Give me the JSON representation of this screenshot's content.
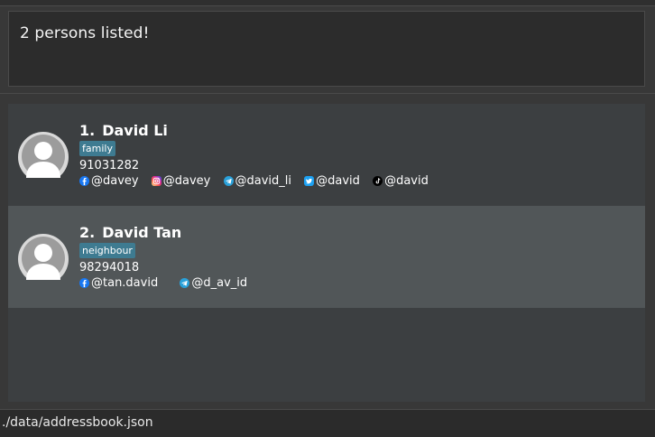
{
  "result_display": {
    "text": "2 persons listed!"
  },
  "persons": [
    {
      "index": "1.",
      "name": "David Li",
      "tag": "family",
      "phone": "91031282",
      "socials": [
        {
          "icon": "facebook-icon",
          "handle": "@davey",
          "color": "#1877f2"
        },
        {
          "icon": "instagram-icon",
          "handle": "@davey",
          "color": "#d6249f"
        },
        {
          "icon": "telegram-icon",
          "handle": "@david_li",
          "color": "#2aa1da"
        },
        {
          "icon": "twitter-icon",
          "handle": "@david",
          "color": "#1da1f2"
        },
        {
          "icon": "tiktok-icon",
          "handle": "@david",
          "color": "#000000"
        }
      ]
    },
    {
      "index": "2.",
      "name": "David Tan",
      "tag": "neighbour",
      "phone": "98294018",
      "socials": [
        {
          "icon": "facebook-icon",
          "handle": "@tan.david",
          "color": "#1877f2"
        },
        {
          "icon": "telegram-icon",
          "handle": "@d_av_id",
          "color": "#2aa1da"
        }
      ]
    }
  ],
  "status_bar": {
    "path": "./data/addressbook.json"
  },
  "colors": {
    "tag_bg": "#3e7b91",
    "selected_card": "#515658",
    "background": "#383838"
  }
}
